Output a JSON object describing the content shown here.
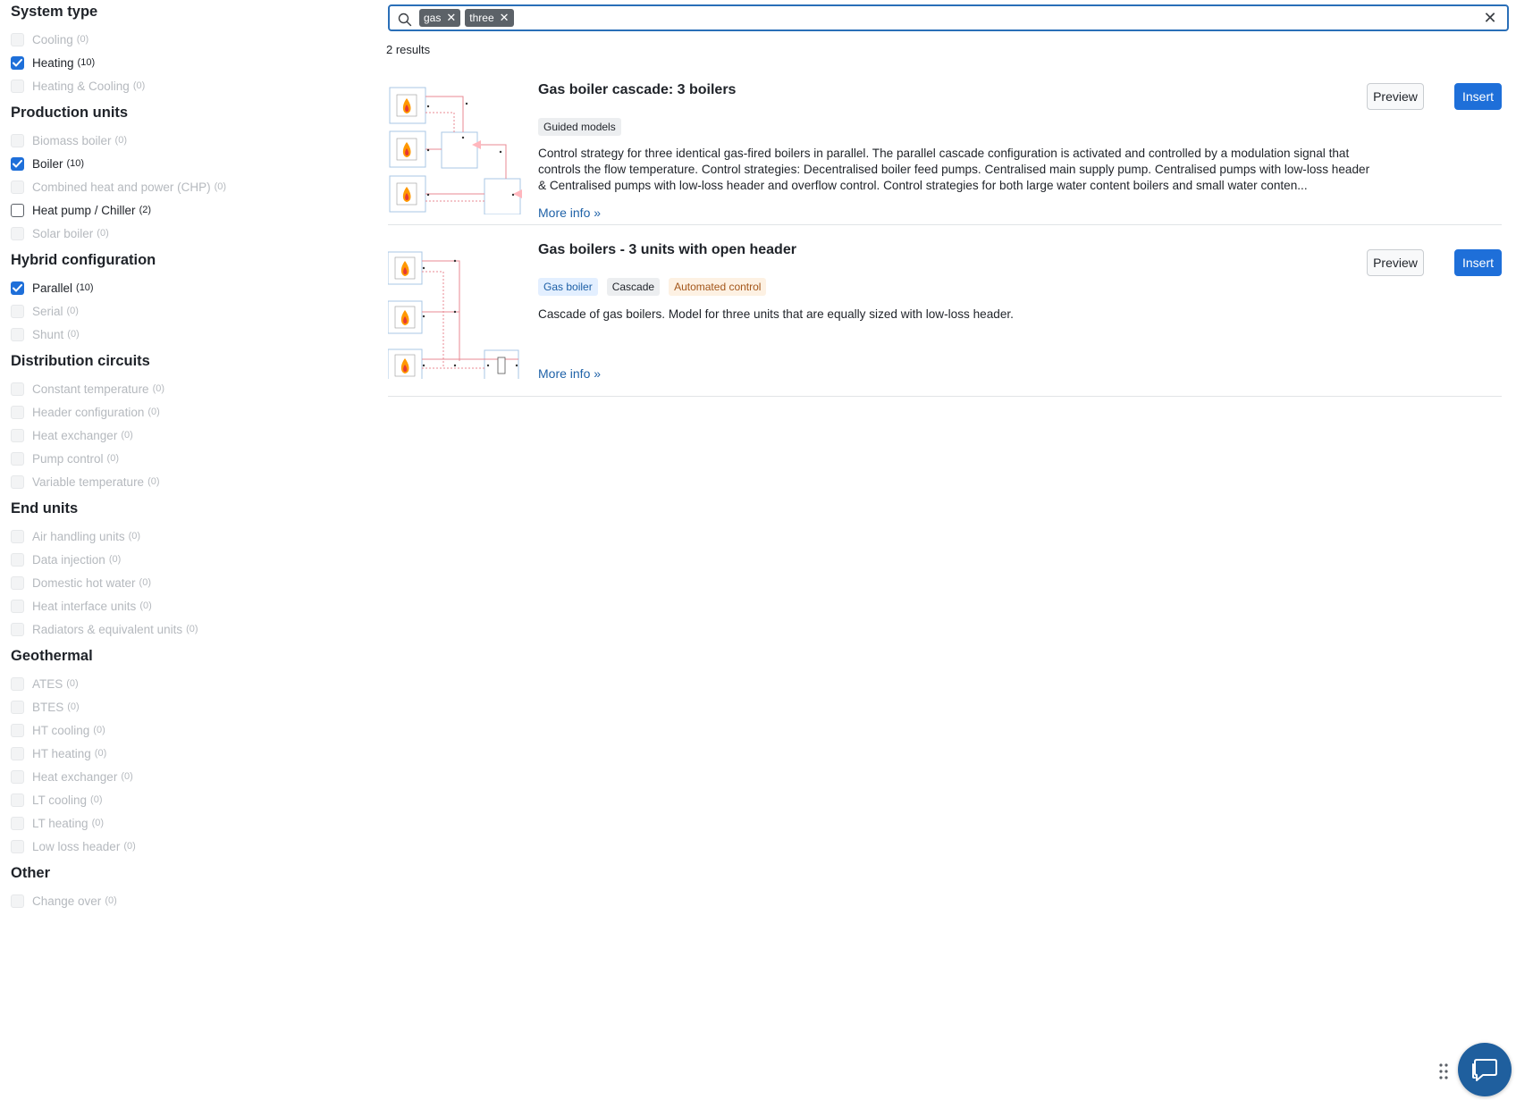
{
  "filters": [
    {
      "title": "System type",
      "items": [
        {
          "label": "Cooling",
          "count": "(0)",
          "state": "disabled"
        },
        {
          "label": "Heating",
          "count": "(10)",
          "state": "checked"
        },
        {
          "label": "Heating & Cooling",
          "count": "(0)",
          "state": "disabled"
        }
      ]
    },
    {
      "title": "Production units",
      "items": [
        {
          "label": "Biomass boiler",
          "count": "(0)",
          "state": "disabled"
        },
        {
          "label": "Boiler",
          "count": "(10)",
          "state": "checked"
        },
        {
          "label": "Combined heat and power (CHP)",
          "count": "(0)",
          "state": "disabled"
        },
        {
          "label": "Heat pump / Chiller",
          "count": "(2)",
          "state": "unchecked"
        },
        {
          "label": "Solar boiler",
          "count": "(0)",
          "state": "disabled"
        }
      ]
    },
    {
      "title": "Hybrid configuration",
      "items": [
        {
          "label": "Parallel",
          "count": "(10)",
          "state": "checked"
        },
        {
          "label": "Serial",
          "count": "(0)",
          "state": "disabled"
        },
        {
          "label": "Shunt",
          "count": "(0)",
          "state": "disabled"
        }
      ]
    },
    {
      "title": "Distribution circuits",
      "items": [
        {
          "label": "Constant temperature",
          "count": "(0)",
          "state": "disabled"
        },
        {
          "label": "Header configuration",
          "count": "(0)",
          "state": "disabled"
        },
        {
          "label": "Heat exchanger",
          "count": "(0)",
          "state": "disabled"
        },
        {
          "label": "Pump control",
          "count": "(0)",
          "state": "disabled"
        },
        {
          "label": "Variable temperature",
          "count": "(0)",
          "state": "disabled"
        }
      ]
    },
    {
      "title": "End units",
      "items": [
        {
          "label": "Air handling units",
          "count": "(0)",
          "state": "disabled"
        },
        {
          "label": "Data injection",
          "count": "(0)",
          "state": "disabled"
        },
        {
          "label": "Domestic hot water",
          "count": "(0)",
          "state": "disabled"
        },
        {
          "label": "Heat interface units",
          "count": "(0)",
          "state": "disabled"
        },
        {
          "label": "Radiators & equivalent units",
          "count": "(0)",
          "state": "disabled"
        }
      ]
    },
    {
      "title": "Geothermal",
      "items": [
        {
          "label": "ATES",
          "count": "(0)",
          "state": "disabled"
        },
        {
          "label": "BTES",
          "count": "(0)",
          "state": "disabled"
        },
        {
          "label": "HT cooling",
          "count": "(0)",
          "state": "disabled"
        },
        {
          "label": "HT heating",
          "count": "(0)",
          "state": "disabled"
        },
        {
          "label": "Heat exchanger",
          "count": "(0)",
          "state": "disabled"
        },
        {
          "label": "LT cooling",
          "count": "(0)",
          "state": "disabled"
        },
        {
          "label": "LT heating",
          "count": "(0)",
          "state": "disabled"
        },
        {
          "label": "Low loss header",
          "count": "(0)",
          "state": "disabled"
        }
      ]
    },
    {
      "title": "Other",
      "items": [
        {
          "label": "Change over",
          "count": "(0)",
          "state": "disabled"
        }
      ]
    }
  ],
  "search": {
    "chips": [
      "gas",
      "three"
    ],
    "value": "",
    "placeholder": ""
  },
  "results_count": "2 results",
  "results": [
    {
      "title": "Gas boiler cascade: 3 boilers",
      "tags": [
        {
          "label": "Guided models",
          "style": "grey"
        }
      ],
      "description": "Control strategy for three identical gas-fired boilers in parallel. The parallel cascade configuration is activated and controlled by a modulation signal that controls the flow temperature. Control strategies: Decentralised boiler feed pumps. Centralised main supply pump. Centralised pumps with low-loss header & Centralised pumps with low-loss header and overflow control. Control strategies for both large water content boilers and small water conten...",
      "more": "More info »",
      "preview": "Preview",
      "insert": "Insert"
    },
    {
      "title": "Gas boilers - 3 units with open header",
      "tags": [
        {
          "label": "Gas boiler",
          "style": "blue"
        },
        {
          "label": "Cascade",
          "style": "grey"
        },
        {
          "label": "Automated control",
          "style": "orange"
        }
      ],
      "description": "Cascade of gas boilers. Model for three units that are equally sized with low-loss header.",
      "more": "More info »",
      "preview": "Preview",
      "insert": "Insert"
    }
  ],
  "icons": {
    "search": "search-icon",
    "clear": "close-icon",
    "chat": "chat-icon",
    "drag": "drag-handle-icon"
  },
  "colors": {
    "accent": "#1e6fd9",
    "link": "#1f62a8",
    "chat": "#1f5f9e"
  }
}
